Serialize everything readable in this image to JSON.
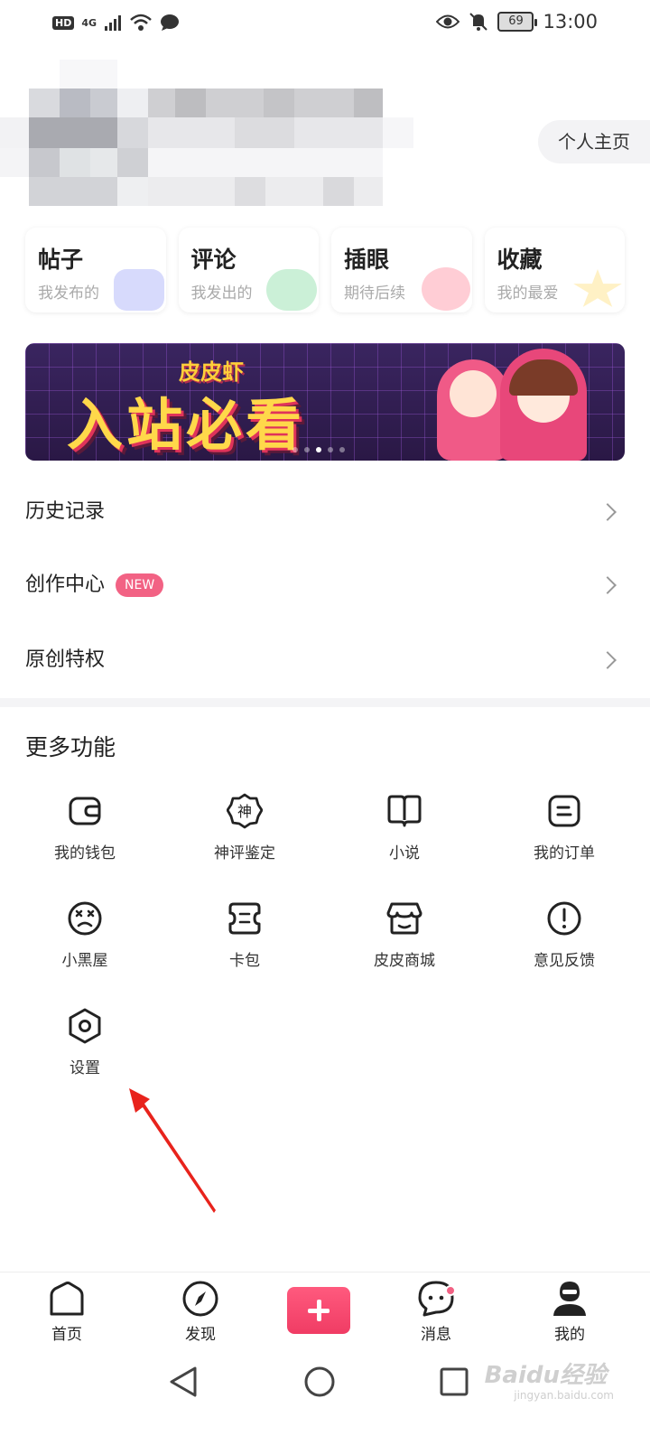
{
  "status_bar": {
    "hd": "HD",
    "network": "4G",
    "battery": "69",
    "time": "13:00"
  },
  "profile": {
    "home_link": "个人主页"
  },
  "cards": [
    {
      "title": "帖子",
      "subtitle": "我发布的"
    },
    {
      "title": "评论",
      "subtitle": "我发出的"
    },
    {
      "title": "插眼",
      "subtitle": "期待后续"
    },
    {
      "title": "收藏",
      "subtitle": "我的最爱"
    }
  ],
  "banner": {
    "small_text": "皮皮虾",
    "big_text": "入站必看",
    "page_count": 5,
    "active_page": 3
  },
  "menu": [
    {
      "label": "历史记录"
    },
    {
      "label": "创作中心",
      "badge": "NEW"
    },
    {
      "label": "原创特权"
    }
  ],
  "more": {
    "title": "更多功能",
    "items": [
      {
        "label": "我的钱包",
        "icon": "wallet-icon"
      },
      {
        "label": "神评鉴定",
        "icon": "shen-badge-icon",
        "glyph": "神"
      },
      {
        "label": "小说",
        "icon": "book-icon"
      },
      {
        "label": "我的订单",
        "icon": "order-icon"
      },
      {
        "label": "小黑屋",
        "icon": "dizzy-face-icon"
      },
      {
        "label": "卡包",
        "icon": "card-pack-icon"
      },
      {
        "label": "皮皮商城",
        "icon": "shop-icon"
      },
      {
        "label": "意见反馈",
        "icon": "feedback-icon"
      },
      {
        "label": "设置",
        "icon": "settings-icon"
      }
    ]
  },
  "bottom_nav": [
    {
      "label": "首页",
      "icon": "home-icon"
    },
    {
      "label": "发现",
      "icon": "compass-icon"
    },
    {
      "label": "消息",
      "icon": "message-icon"
    },
    {
      "label": "我的",
      "icon": "profile-icon"
    }
  ],
  "watermark": {
    "brand": "Baidu经验",
    "url": "jingyan.baidu.com"
  },
  "colors": {
    "accent": "#f26284",
    "banner_bg": "#2a1845",
    "annotation_arrow": "#e8231c"
  }
}
